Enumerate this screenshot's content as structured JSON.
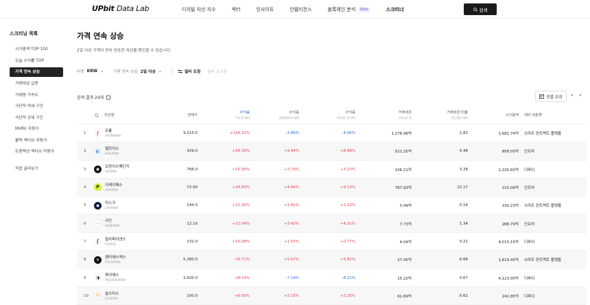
{
  "header": {
    "logo_main": "UPbit",
    "logo_sub": "Data Lab",
    "nav": [
      {
        "label": "디지털 자산 지수"
      },
      {
        "label": "섹터"
      },
      {
        "label": "인사이트"
      },
      {
        "label": "인텔리전스"
      },
      {
        "label": "블록체인 분석",
        "badge": "Beta"
      },
      {
        "label": "스크리너"
      }
    ],
    "search_label": "검색"
  },
  "sidebar": {
    "title": "스크리닝 목록",
    "items": [
      {
        "label": "시가총액 TOP 100"
      },
      {
        "label": "오늘 수익률 TOP"
      },
      {
        "label": "가격 연속 상승"
      },
      {
        "label": "거래대금 급증"
      },
      {
        "label": "거래량 가속도"
      },
      {
        "label": "극단적 약세 구간"
      },
      {
        "label": "극단적 강세 구간"
      },
      {
        "label": "MVRV 저평가"
      },
      {
        "label": "활력 액티브 저평가"
      },
      {
        "label": "트랜잭션 액티브 저평가"
      }
    ],
    "extra": "직접 골라보기"
  },
  "main": {
    "title": "가격 연속 상승",
    "description": "2일 이상 가격이 연속 상승한 자산을 확인할 수 있습니다.",
    "filters": [
      {
        "label": "마켓",
        "value": "KRW"
      },
      {
        "label": "가격 연속 상승",
        "value": "2일 이상"
      }
    ],
    "filter_button": "필터 조정",
    "reset": "필터 초기화",
    "result_count": "검색 결과 24개",
    "sort_button": "정렬 조정"
  },
  "table": {
    "headers": {
      "asset": "자산명",
      "price": "현재가",
      "return_7d": "수익률",
      "return_7d_sub": "7일 전 대비",
      "return_prev": "수익률",
      "return_prev_sub": "장동(09시) 대비",
      "return_24h": "수익률",
      "return_24h_sub": "24시간 전 대비",
      "volume": "거래대금",
      "volume_sub": "24시간 합",
      "volume_ratio": "거래대금 비율",
      "volume_ratio_sub": "7일 평균 대비",
      "marketcap": "시가총액",
      "sector": "섹터 대분류"
    },
    "rows": [
      {
        "rank": "1",
        "name": "프롬",
        "code": "FROM/KRW",
        "price": "9,215.0",
        "r7d": "+134.12%",
        "rprev": "-3.86%",
        "r24h": "-4.06%",
        "volume": "1,178.48억",
        "ratio": "1.82",
        "mcap": "1,681.74억",
        "sector": "스마트 컨트랙트 플랫폼",
        "icon": "ƒ",
        "color": "#ffffff",
        "fg": "#ff4d6d",
        "prev_dir": "down",
        "r24_dir": "down"
      },
      {
        "rank": "2",
        "name": "엘모어스",
        "code": "DOS/KRW",
        "price": "429.0",
        "r7d": "+38.39%",
        "rprev": "+9.44%",
        "r24h": "+8.88%",
        "volume": "522.25억",
        "ratio": "5.46",
        "mcap": "858.00억",
        "sector": "인프라",
        "icon": "◐",
        "color": "#e5f1ff",
        "fg": "#3b82f6",
        "prev_dir": "up",
        "r24_dir": "up"
      },
      {
        "rank": "3",
        "name": "오징어스페인지",
        "code": "QX/KRW",
        "price": "766.0",
        "r7d": "+25.99%",
        "rprev": "+3.79%",
        "r24h": "+3.23%",
        "volume": "106.21억",
        "ratio": "3.28",
        "mcap": "1,225.60억",
        "sector": "디파이",
        "icon": "◉",
        "color": "#111111",
        "fg": "#ffffff",
        "prev_dir": "up",
        "r24_dir": "up"
      },
      {
        "rank": "4",
        "name": "지케이패스",
        "code": "ZKP/KRW",
        "price": "72.90",
        "r7d": "+24.83%",
        "rprev": "+4.44%",
        "r24h": "+9.13%",
        "volume": "787.93억",
        "ratio": "22.17",
        "mcap": "215.06억",
        "sector": "인프라",
        "icon": "P",
        "color": "#d4f23b",
        "fg": "#111111",
        "prev_dir": "up",
        "r24_dir": "up"
      },
      {
        "rank": "5",
        "name": "리스크",
        "code": "LSK/KRW",
        "price": "144.0",
        "r7d": "+13.39%",
        "rprev": "+1.41%",
        "r24h": "+2.13%",
        "volume": "5.49억",
        "ratio": "0.16",
        "mcap": "330.23억",
        "sector": "스마트 컨트랙트 플랫폼",
        "icon": "◆",
        "color": "#0a1e3c",
        "fg": "#ffffff",
        "prev_dir": "up",
        "r24_dir": "up"
      },
      {
        "rank": "6",
        "name": "사인",
        "code": "SIGN/KRW",
        "price": "12.10",
        "r7d": "+12.04%",
        "rprev": "+3.42%",
        "r24h": "+4.31%",
        "volume": "7.73억",
        "ratio": "1.34",
        "mcap": "288.79억",
        "sector": "인프라",
        "icon": "~",
        "color": "#ffffff",
        "fg": "#e8a33d",
        "prev_dir": "up",
        "r24_dir": "up"
      },
      {
        "rank": "7",
        "name": "힐리파이낸스",
        "code": "FF/KRW",
        "price": "131.0",
        "r7d": "+10.08%",
        "rprev": "+1.55%",
        "r24h": "+0.77%",
        "volume": "6.04억",
        "ratio": "0.21",
        "mcap": "4,015.15억",
        "sector": "디파이",
        "icon": "ʃ",
        "color": "#ffffff",
        "fg": "#222222",
        "prev_dir": "up",
        "r24_dir": "up"
      },
      {
        "rank": "8",
        "name": "엠티에스엑스",
        "code": "EGLD/KRW",
        "price": "5,280.0",
        "r7d": "+8.71%",
        "rprev": "+5.07%",
        "r24h": "+5.81%",
        "volume": "27.45억",
        "ratio": "6.66",
        "mcap": "1,619.45억",
        "sector": "스마트 컨트랙트 플랫폼",
        "icon": "✕",
        "color": "#111111",
        "fg": "#ffffff",
        "prev_dir": "up",
        "r24_dir": "up"
      },
      {
        "rank": "9",
        "name": "파이에스",
        "code": "PEVERSE/KRW",
        "price": "1,420.0",
        "r7d": "+8.15%",
        "rprev": "-7.19%",
        "r24h": "-8.21%",
        "volume": "15.22억",
        "ratio": "0.67",
        "mcap": "4,123.00억",
        "sector": "디파이",
        "icon": "◑",
        "color": "#ffffff",
        "fg": "#111111",
        "prev_dir": "down",
        "r24_dir": "down"
      },
      {
        "rank": "10",
        "name": "슬스타스",
        "code": "SLX/KRW",
        "price": "100.0",
        "r7d": "+6.50%",
        "rprev": "+2.15%",
        "r24h": "+2.25%",
        "volume": "61.69억",
        "ratio": "0.62",
        "mcap": "242.85억",
        "sector": "디파이",
        "icon": "%",
        "color": "#ffffff",
        "fg": "#e8a33d",
        "prev_dir": "up",
        "r24_dir": "up"
      }
    ]
  }
}
